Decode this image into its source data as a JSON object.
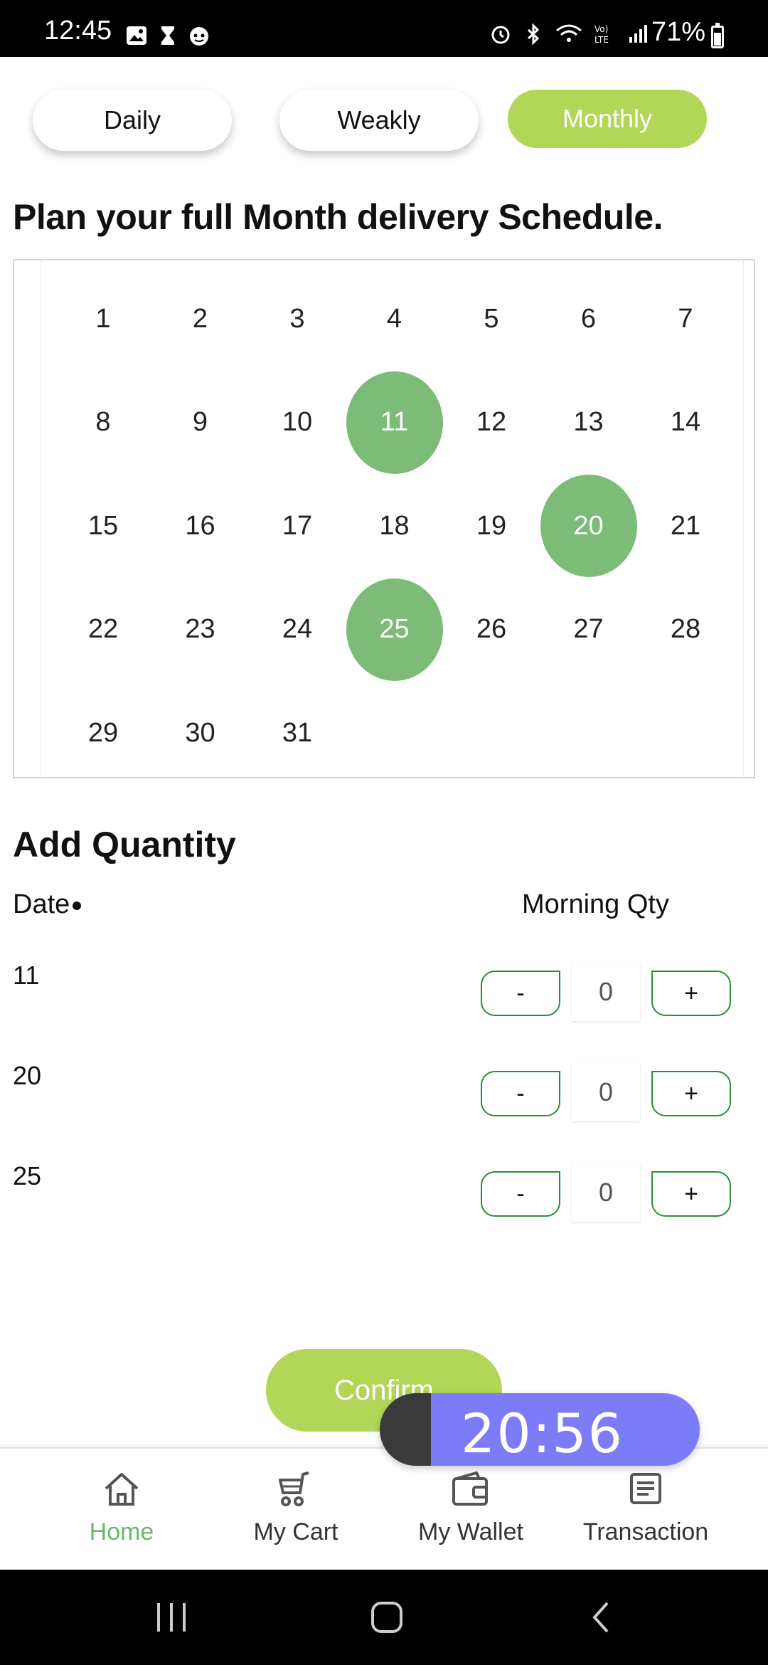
{
  "status_bar": {
    "time": "12:45",
    "battery_percent": "71%",
    "left_icons": [
      "gallery-icon",
      "hourglass-icon",
      "cat-face-icon"
    ],
    "right_icons": [
      "alarm-icon",
      "bluetooth-icon",
      "wifi-icon",
      "volte-icon",
      "signal-icon"
    ]
  },
  "tabs": [
    {
      "label": "Daily",
      "active": false
    },
    {
      "label": "Weakly",
      "active": false
    },
    {
      "label": "Monthly",
      "active": true
    }
  ],
  "plan_title": "Plan your full Month delivery Schedule.",
  "calendar": {
    "days": [
      "1",
      "2",
      "3",
      "4",
      "5",
      "6",
      "7",
      "8",
      "9",
      "10",
      "11",
      "12",
      "13",
      "14",
      "15",
      "16",
      "17",
      "18",
      "19",
      "20",
      "21",
      "22",
      "23",
      "24",
      "25",
      "26",
      "27",
      "28",
      "29",
      "30",
      "31"
    ],
    "selected": [
      "11",
      "20",
      "25"
    ],
    "selected_color": "#7cbb78"
  },
  "add_quantity": {
    "title": "Add Quantity",
    "date_header": "Date",
    "morning_header": "Morning Qty",
    "rows": [
      {
        "date": "11",
        "qty": "0"
      },
      {
        "date": "20",
        "qty": "0"
      },
      {
        "date": "25",
        "qty": "0"
      }
    ],
    "minus_label": "-",
    "plus_label": "+"
  },
  "confirm_label": "Confirm",
  "timer": "20:56",
  "bottom_nav": {
    "home": "Home",
    "cart": "My Cart",
    "wallet": "My Wallet",
    "transaction": "Transaction"
  },
  "colors": {
    "accent": "#b1d658",
    "calendar_selected": "#7cbb78",
    "stepper_border": "#2e8b3a",
    "nav_active": "#6ab56a",
    "timer_bg": "#7b7cf6"
  }
}
